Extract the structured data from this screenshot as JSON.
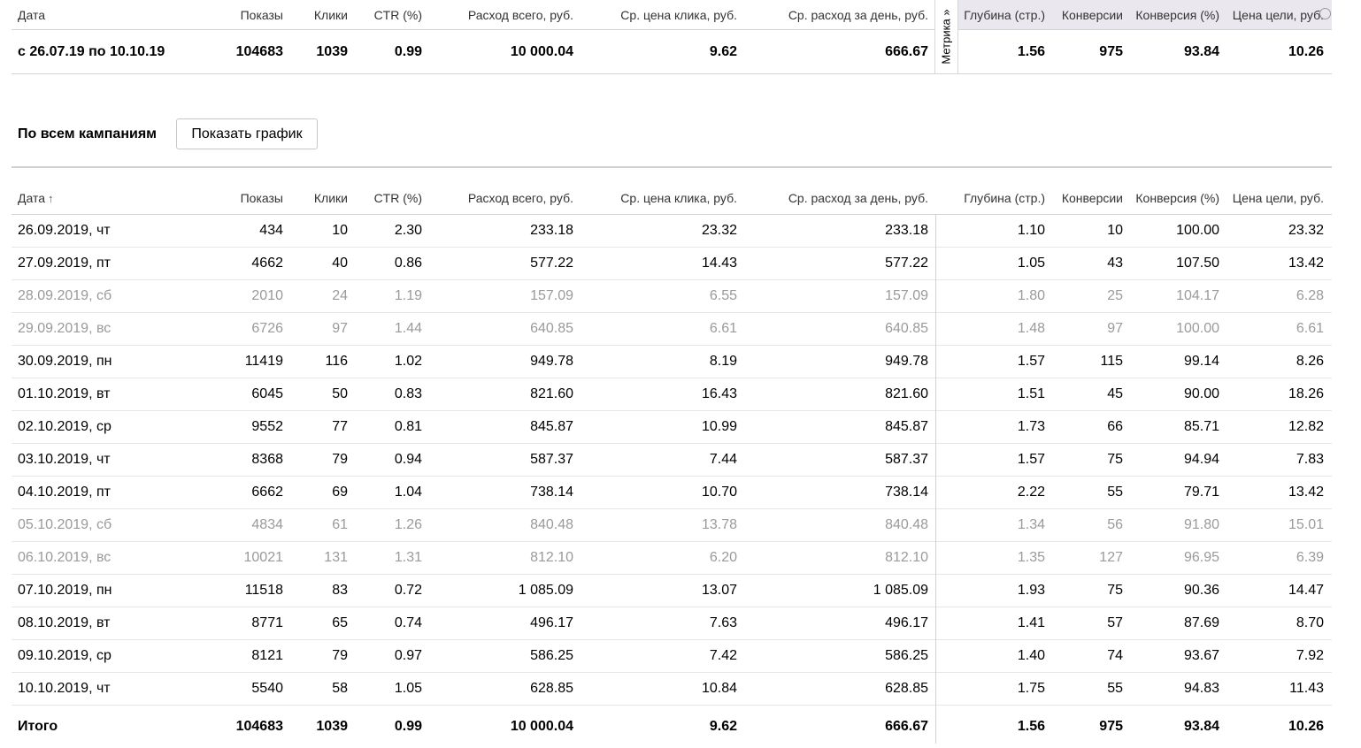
{
  "summary": {
    "headers": {
      "date": "Дата",
      "shows": "Показы",
      "clicks": "Клики",
      "ctr": "CTR (%)",
      "spend": "Расход всего, руб.",
      "cpc": "Ср. цена клика, руб.",
      "daily": "Ср. расход за день, руб.",
      "depth": "Глубина (стр.)",
      "conv": "Конверсии",
      "convrate": "Конверсия (%)",
      "goal": "Цена цели, руб."
    },
    "values": {
      "date": "с 26.07.19 по 10.10.19",
      "shows": "104683",
      "clicks": "1039",
      "ctr": "0.99",
      "spend": "10 000.04",
      "cpc": "9.62",
      "daily": "666.67",
      "depth": "1.56",
      "conv": "975",
      "convrate": "93.84",
      "goal": "10.26"
    },
    "metrika_label": "Метрика »"
  },
  "campaigns": {
    "title": "По всем кампаниям",
    "chart_button": "Показать график"
  },
  "table": {
    "headers": {
      "date": "Дата",
      "sort_icon": "↑",
      "shows": "Показы",
      "clicks": "Клики",
      "ctr": "CTR (%)",
      "spend": "Расход всего, руб.",
      "cpc": "Ср. цена клика, руб.",
      "daily": "Ср. расход за день, руб.",
      "depth": "Глубина (стр.)",
      "conv": "Конверсии",
      "convrate": "Конверсия (%)",
      "goal": "Цена цели, руб."
    },
    "rows": [
      {
        "date": "26.09.2019, чт",
        "shows": "434",
        "clicks": "10",
        "ctr": "2.30",
        "spend": "233.18",
        "cpc": "23.32",
        "daily": "233.18",
        "depth": "1.10",
        "conv": "10",
        "convrate": "100.00",
        "goal": "23.32"
      },
      {
        "date": "27.09.2019, пт",
        "shows": "4662",
        "clicks": "40",
        "ctr": "0.86",
        "spend": "577.22",
        "cpc": "14.43",
        "daily": "577.22",
        "depth": "1.05",
        "conv": "43",
        "convrate": "107.50",
        "goal": "13.42"
      },
      {
        "date": "28.09.2019, сб",
        "shows": "2010",
        "clicks": "24",
        "ctr": "1.19",
        "spend": "157.09",
        "cpc": "6.55",
        "daily": "157.09",
        "depth": "1.80",
        "conv": "25",
        "convrate": "104.17",
        "goal": "6.28",
        "weekend": true
      },
      {
        "date": "29.09.2019, вс",
        "shows": "6726",
        "clicks": "97",
        "ctr": "1.44",
        "spend": "640.85",
        "cpc": "6.61",
        "daily": "640.85",
        "depth": "1.48",
        "conv": "97",
        "convrate": "100.00",
        "goal": "6.61",
        "weekend": true
      },
      {
        "date": "30.09.2019, пн",
        "shows": "11419",
        "clicks": "116",
        "ctr": "1.02",
        "spend": "949.78",
        "cpc": "8.19",
        "daily": "949.78",
        "depth": "1.57",
        "conv": "115",
        "convrate": "99.14",
        "goal": "8.26"
      },
      {
        "date": "01.10.2019, вт",
        "shows": "6045",
        "clicks": "50",
        "ctr": "0.83",
        "spend": "821.60",
        "cpc": "16.43",
        "daily": "821.60",
        "depth": "1.51",
        "conv": "45",
        "convrate": "90.00",
        "goal": "18.26"
      },
      {
        "date": "02.10.2019, ср",
        "shows": "9552",
        "clicks": "77",
        "ctr": "0.81",
        "spend": "845.87",
        "cpc": "10.99",
        "daily": "845.87",
        "depth": "1.73",
        "conv": "66",
        "convrate": "85.71",
        "goal": "12.82"
      },
      {
        "date": "03.10.2019, чт",
        "shows": "8368",
        "clicks": "79",
        "ctr": "0.94",
        "spend": "587.37",
        "cpc": "7.44",
        "daily": "587.37",
        "depth": "1.57",
        "conv": "75",
        "convrate": "94.94",
        "goal": "7.83"
      },
      {
        "date": "04.10.2019, пт",
        "shows": "6662",
        "clicks": "69",
        "ctr": "1.04",
        "spend": "738.14",
        "cpc": "10.70",
        "daily": "738.14",
        "depth": "2.22",
        "conv": "55",
        "convrate": "79.71",
        "goal": "13.42"
      },
      {
        "date": "05.10.2019, сб",
        "shows": "4834",
        "clicks": "61",
        "ctr": "1.26",
        "spend": "840.48",
        "cpc": "13.78",
        "daily": "840.48",
        "depth": "1.34",
        "conv": "56",
        "convrate": "91.80",
        "goal": "15.01",
        "weekend": true
      },
      {
        "date": "06.10.2019, вс",
        "shows": "10021",
        "clicks": "131",
        "ctr": "1.31",
        "spend": "812.10",
        "cpc": "6.20",
        "daily": "812.10",
        "depth": "1.35",
        "conv": "127",
        "convrate": "96.95",
        "goal": "6.39",
        "weekend": true
      },
      {
        "date": "07.10.2019, пн",
        "shows": "11518",
        "clicks": "83",
        "ctr": "0.72",
        "spend": "1 085.09",
        "cpc": "13.07",
        "daily": "1 085.09",
        "depth": "1.93",
        "conv": "75",
        "convrate": "90.36",
        "goal": "14.47"
      },
      {
        "date": "08.10.2019, вт",
        "shows": "8771",
        "clicks": "65",
        "ctr": "0.74",
        "spend": "496.17",
        "cpc": "7.63",
        "daily": "496.17",
        "depth": "1.41",
        "conv": "57",
        "convrate": "87.69",
        "goal": "8.70"
      },
      {
        "date": "09.10.2019, ср",
        "shows": "8121",
        "clicks": "79",
        "ctr": "0.97",
        "spend": "586.25",
        "cpc": "7.42",
        "daily": "586.25",
        "depth": "1.40",
        "conv": "74",
        "convrate": "93.67",
        "goal": "7.92"
      },
      {
        "date": "10.10.2019, чт",
        "shows": "5540",
        "clicks": "58",
        "ctr": "1.05",
        "spend": "628.85",
        "cpc": "10.84",
        "daily": "628.85",
        "depth": "1.75",
        "conv": "55",
        "convrate": "94.83",
        "goal": "11.43"
      }
    ],
    "total": {
      "date": "Итого",
      "shows": "104683",
      "clicks": "1039",
      "ctr": "0.99",
      "spend": "10 000.04",
      "cpc": "9.62",
      "daily": "666.67",
      "depth": "1.56",
      "conv": "975",
      "convrate": "93.84",
      "goal": "10.26"
    }
  }
}
